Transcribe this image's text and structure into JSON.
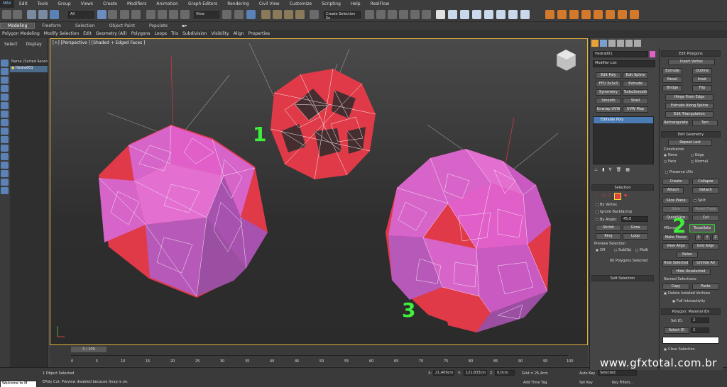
{
  "menu": {
    "app_logo": "MAX",
    "items": [
      "Edit",
      "Tools",
      "Group",
      "Views",
      "Create",
      "Modifiers",
      "Animation",
      "Graph Editors",
      "Rendering",
      "Civil View",
      "Customize",
      "Scripting",
      "Help",
      "RealFlow"
    ]
  },
  "toolbar": {
    "filter_value": "All",
    "view_value": "View",
    "named_selection_placeholder": "Create Selection Se"
  },
  "ribbon": {
    "tabs": [
      "Modeling",
      "Freeform",
      "Selection",
      "Object Paint",
      "Populate"
    ],
    "active_tab": "Modeling",
    "groups": [
      "Polygon Modeling",
      "Modify Selection",
      "Edit",
      "Geometry (All)",
      "Polygons",
      "Loops",
      "Tris",
      "Subdivision",
      "Visibility",
      "Align",
      "Properties"
    ]
  },
  "scene_explorer": {
    "tabs": [
      "Select",
      "Display"
    ],
    "column_header": "Name (Sorted Ascen",
    "rows": [
      "Hedra001"
    ],
    "selected_row": "Hedra001"
  },
  "viewport": {
    "label": "[+] [Perspective ] [Shaded + Edged Faces ]",
    "annotations": [
      "1",
      "2",
      "3"
    ]
  },
  "timeline": {
    "slider": "0 / 100",
    "ticks": [
      "0",
      "5",
      "10",
      "15",
      "20",
      "25",
      "30",
      "35",
      "40",
      "45",
      "50",
      "55",
      "60",
      "65",
      "70",
      "75",
      "80",
      "85",
      "90",
      "95",
      "100"
    ]
  },
  "status": {
    "listener": "Welcome to M",
    "selection_info": "1 Object Selected",
    "prompt": "EPoly Cut: Preview disabled because Snap is on.",
    "x_label": "X:",
    "x_value": "21,409cm",
    "y_label": "Y:",
    "y_value": "121,833cm",
    "z_label": "Z:",
    "z_value": "0,0cm",
    "grid": "Grid = 25,4cm",
    "add_time_tag": "Add Time Tag",
    "auto_key": "Auto Key",
    "set_key": "Set Key",
    "selected_dropdown": "Selected",
    "key_filters": "Key Filters..."
  },
  "modifier_panel": {
    "object_name": "Hedra001",
    "object_color": "#e060c8",
    "modifier_list": "Modifier List",
    "modifier_buttons": [
      [
        "Edit Poly",
        "Edit Spline"
      ],
      [
        "FFD 3x3x3",
        "Extrude"
      ],
      [
        "Symmetry",
        "TurboSmooth"
      ],
      [
        "Smooth",
        "Shell"
      ],
      [
        "Unwrap UVW",
        "UVW Map"
      ]
    ],
    "stack_item": "Editable Poly",
    "selection": {
      "header": "Selection",
      "by_vertex": "By Vertex",
      "ignore_backfacing": "Ignore Backfacing",
      "by_angle": "By Angle:",
      "by_angle_value": "45,0",
      "shrink": "Shrink",
      "grow": "Grow",
      "ring": "Ring",
      "loop": "Loop",
      "preview_selection": "Preview Selection",
      "off": "Off",
      "subobj": "SubObj",
      "multi": "Multi",
      "info": "60 Polygons Selected"
    },
    "soft_selection": "Soft Selection"
  },
  "edit_polygons": {
    "header": "Edit Polygons",
    "insert_vertex": "Insert Vertex",
    "rows": [
      [
        "Extrude",
        "Outline"
      ],
      [
        "Bevel",
        "Inset"
      ],
      [
        "Bridge",
        "Flip"
      ]
    ],
    "hinge": "Hinge From Edge",
    "extrude_spline": "Extrude Along Spline",
    "edit_triangulation": "Edit Triangulation",
    "retriangulate": "Retriangulate",
    "turn": "Turn"
  },
  "edit_geometry": {
    "header": "Edit Geometry",
    "repeat_last": "Repeat Last",
    "constraints": "Constraints",
    "none": "None",
    "edge": "Edge",
    "face": "Face",
    "normal": "Normal",
    "preserve_uvs": "Preserve UVs",
    "create": "Create",
    "collapse": "Collapse",
    "attach": "Attach",
    "detach": "Detach",
    "slice_plane": "Slice Plane",
    "split": "Split",
    "slice": "Slice",
    "reset_plane": "Reset Plane",
    "quickslice": "QuickSlice",
    "cut": "Cut",
    "msmooth": "MSmooth",
    "tessellate": "Tessellate",
    "make_planar": "Make Planar",
    "x": "X",
    "y": "Y",
    "z": "Z",
    "view_align": "View Align",
    "grid_align": "Grid Align",
    "relax": "Relax",
    "hide_selected": "Hide Selected",
    "unhide_all": "Unhide All",
    "hide_unselected": "Hide Unselected",
    "named_selections": "Named Selections:",
    "copy": "Copy",
    "paste": "Paste",
    "delete_isolated": "Delete Isolated Vertices",
    "full_interactivity": "Full Interactivity"
  },
  "material_ids": {
    "header": "Polygon: Material IDs",
    "set_id": "Set ID:",
    "set_id_value": "2",
    "select_id": "Select ID",
    "select_id_value": "2",
    "clear_selection": "Clear Selection"
  },
  "watermark": "www.gfxtotal.com.br",
  "colors": {
    "accent_green": "#3ff03a",
    "viewport_border": "#e4b43a",
    "poly_red": "#e03a48",
    "poly_pink": "#d765c9",
    "poly_purple": "#9b4fa3"
  }
}
